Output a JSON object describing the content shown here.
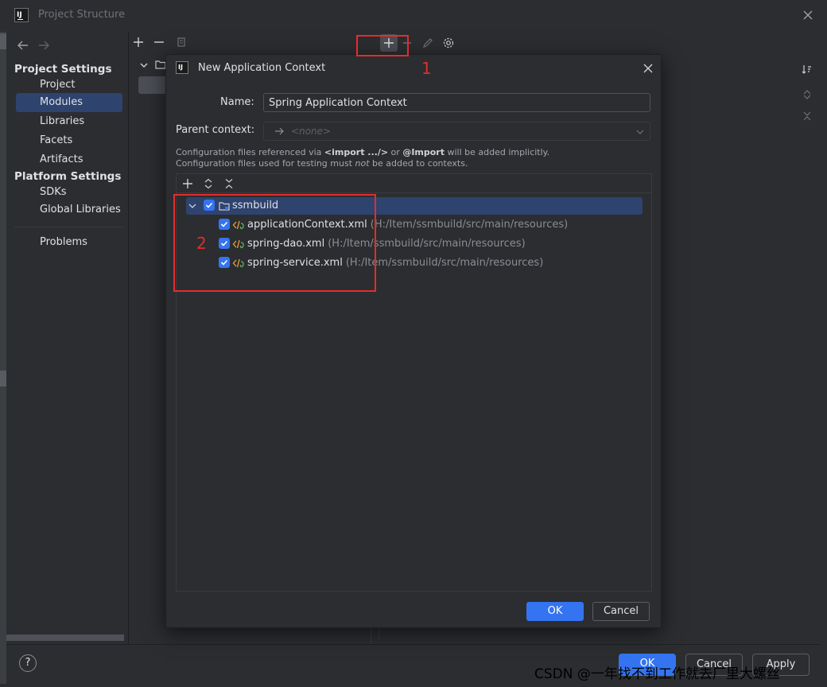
{
  "window": {
    "title": "Project Structure"
  },
  "sidebar": {
    "project_settings_header": "Project Settings",
    "platform_settings_header": "Platform Settings",
    "items": [
      {
        "label": "Project"
      },
      {
        "label": "Modules",
        "selected": true
      },
      {
        "label": "Libraries"
      },
      {
        "label": "Facets"
      },
      {
        "label": "Artifacts"
      },
      {
        "label": "SDKs"
      },
      {
        "label": "Global Libraries"
      },
      {
        "label": "Problems"
      }
    ]
  },
  "dialog": {
    "title": "New Application Context",
    "name_label": "Name:",
    "name_value": "Spring Application Context",
    "parent_label": "Parent context:",
    "parent_value": "<none>",
    "hint_line1_a": "Configuration files referenced via ",
    "hint_line1_b": "<import .../>",
    "hint_line1_c": " or ",
    "hint_line1_d": "@Import",
    "hint_line1_e": " will be added implicitly.",
    "hint_line2_a": "Configuration files used for testing must ",
    "hint_line2_b": "not",
    "hint_line2_c": " be added to contexts.",
    "tree": {
      "root": {
        "label": "ssmbuild",
        "checked": true
      },
      "files": [
        {
          "name": "applicationContext.xml",
          "path": "(H:/Item/ssmbuild/src/main/resources)",
          "checked": true
        },
        {
          "name": "spring-dao.xml",
          "path": "(H:/Item/ssmbuild/src/main/resources)",
          "checked": true
        },
        {
          "name": "spring-service.xml",
          "path": "(H:/Item/ssmbuild/src/main/resources)",
          "checked": true
        }
      ]
    },
    "ok_label": "OK",
    "cancel_label": "Cancel"
  },
  "outer_buttons": {
    "ok": "OK",
    "cancel": "Cancel",
    "apply": "Apply",
    "help": "?"
  },
  "annotations": {
    "step1": "1",
    "step2": "2",
    "color": "#e52c2c"
  },
  "watermark": "CSDN @一年找不到工作就去厂里大螺丝",
  "colors": {
    "accent": "#3574f0",
    "selection": "#2e436e",
    "background": "#2b2d30"
  }
}
